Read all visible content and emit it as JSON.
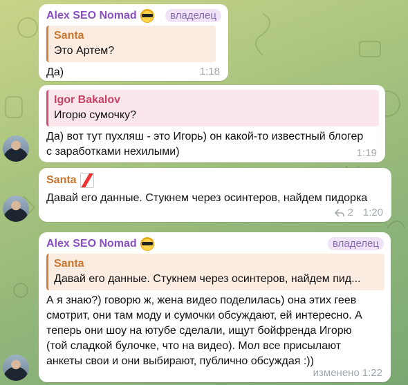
{
  "chat": {
    "messages": [
      {
        "sender": "Alex SEO Nomad",
        "badge": "владелец",
        "quote_name": "Santa",
        "quote_text": "Это Артем?",
        "text": "Да)",
        "time": "1:18"
      },
      {
        "quote_name": "Igor Bakalov",
        "quote_text": "Игорю сумочку?",
        "text_line1": "Да) вот тут пухляш - это Игорь) он какой-то известный блогер",
        "text_line2": "с заработками нехилыми)",
        "time": "1:19"
      },
      {
        "sender": "Santa",
        "text": "Давай его данные. Стукнем через осинтеров, найдем пидорка",
        "replies": "2",
        "time": "1:20"
      },
      {
        "sender": "Alex SEO Nomad",
        "badge": "владелец",
        "quote_name": "Santa",
        "quote_text": "Давай его данные. Стукнем через осинтеров, найдем пид...",
        "text_line1": "А я знаю?) говорю ж, жена видео поделилась) она этих геев",
        "text_line2": "смотрит, они там моду и сумочки обсуждают, ей интересно. А",
        "text_line3": "теперь они шоу на ютубе сделали, ищут бойфренда Игорю",
        "text_line4": "(той сладкой булочке, что на видео). Мол все присылают",
        "text_line5": "анкеты свои и они выбирают, публично обсуждая :))",
        "edited": "изменено",
        "time": "1:22"
      }
    ]
  }
}
